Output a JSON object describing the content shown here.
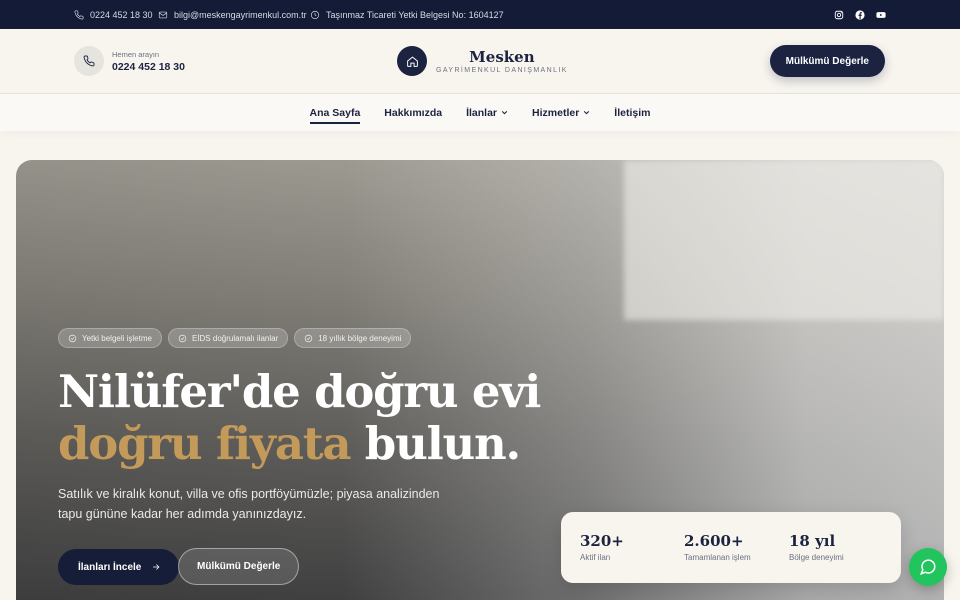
{
  "topbar": {
    "phone": "0224 452 18 30",
    "email": "bilgi@meskengayrimenkul.com.tr",
    "license": "Taşınmaz Ticareti Yetki Belgesi No: 1604127",
    "social": [
      "instagram-icon",
      "facebook-icon",
      "youtube-icon"
    ]
  },
  "header": {
    "call_label": "Hemen arayın",
    "call_number": "0224 452 18 30",
    "brand_name": "Mesken",
    "brand_sub": "GAYRİMENKUL DANIŞMANLIK",
    "cta": "Mülkümü Değerle"
  },
  "nav": {
    "items": [
      {
        "label": "Ana Sayfa",
        "active": true
      },
      {
        "label": "Hakkımızda"
      },
      {
        "label": "İlanlar",
        "dropdown": true
      },
      {
        "label": "Hizmetler",
        "dropdown": true
      },
      {
        "label": "İletişim"
      }
    ]
  },
  "hero": {
    "badges": [
      "Yetki belgeli işletme",
      "EİDS doğrulamalı ilanlar",
      "18 yıllık bölge deneyimi"
    ],
    "title_line1": "Nilüfer'de doğru evi",
    "title_gold": "doğru fiyata",
    "title_rest": " bulun.",
    "lead": "Satılık ve kiralık konut, villa ve ofis portföyümüzle; piyasa analizinden tapu gününe kadar her adımda yanınızdayız.",
    "primary_button": "İlanları İncele",
    "secondary_button": "Mülkümü Değerle"
  },
  "stats": [
    {
      "value": "320+",
      "label": "Aktif ilan"
    },
    {
      "value": "2.600+",
      "label": "Tamamlanan işlem"
    },
    {
      "value": "18 yıl",
      "label": "Bölge deneyimi"
    }
  ],
  "colors": {
    "navy": "#1b2340",
    "gold": "#c49a5b",
    "whatsapp": "#22c45e",
    "cream": "#f8f5ef"
  }
}
